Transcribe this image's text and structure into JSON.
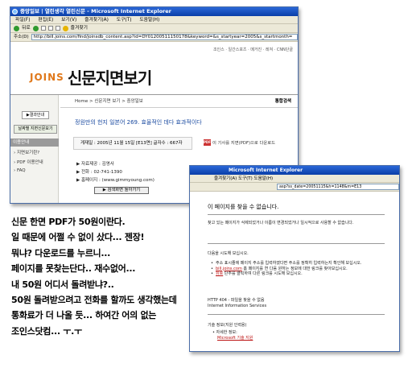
{
  "window1": {
    "title": "중앙일보 | 열린생각 열린신문 - Microsoft Internet Explorer",
    "menu": [
      "파일(F)",
      "편집(E)",
      "보기(V)",
      "즐겨찾기(A)",
      "도구(T)",
      "도움말(H)"
    ],
    "toolbar": {
      "back": "뒤로",
      "favorites": "즐겨찾기"
    },
    "address_label": "주소(D)",
    "address_url": "http://bill.joins.com/find/joinsdb_content.asp?id=DY01200511150178&keyword=&s_startyear=2005&s_startmonth=",
    "top_links": "조인스 · 일간스포츠 · 메거진 · 레져 · CNN단골",
    "logo_brand": "JOINS",
    "logo_service": "신문지면보기",
    "breadcrumb": "Home > 신문지면 보기 > 중앙일보",
    "integrated_search": "통합검색",
    "left_panel": {
      "result_button": "▶결과안내",
      "date_button": "날짜별 지면신문보기",
      "section_head": "이용안내",
      "items": [
        "지면보기란?",
        "PDF 이용안내",
        "FAQ"
      ]
    },
    "article": {
      "title": "정원만의 헌지 일본어 269. 효율적인 데다 효과적이다",
      "meta": "게재일 : 2005년 11월 15일 [E13면]   글자수 : 667자",
      "pdf_link": "이 기사를 지면(PDF)으로 다운로드",
      "pdf_icon_text": "PDF",
      "info": [
        "▶ 자료제공 : 김영사",
        "▶ 전화 : 02-741-1390",
        "▶ 홈페이지 : (www.gimmyoung.com)"
      ],
      "scrap_button": "▶ 검색화면 돌아가기"
    }
  },
  "window2": {
    "title": "Microsoft Internet Explorer",
    "menu": "즐겨찾기(A)   도구(T)   도움말(H)",
    "address_url": "asp?ss_date=20051115&h=1148&m=E13",
    "error": {
      "title": "이 페이지를 찾을 수 없습니다.",
      "desc": "찾고 있는 페이지가 삭제되었거나 이름이 변경되었거나 일시적으로 사용할 수 없습니다.",
      "try_head": "다음을 시도해 보십시오.",
      "bullets": [
        "주소 표시줄에 페이지 주소를 입력하였다면 주소를 정확히 입력하는지 확인해 보십시오.",
        "bill.joins.com",
        "홈 페이지를 연 다음 원하는 정보에 대한 링크를 찾아보십시오.",
        "뒤로",
        "단추를 클릭하여 다른 링크를 시도해 보십시오."
      ],
      "http_line1": "HTTP 404 - 파일을 찾을 수 없음",
      "http_line2": "Internet Information Services",
      "tech_head": "기술 정보(지원 인력용)",
      "tech_item1": "자세한 정보:",
      "tech_item2": "Microsoft 기술 지원"
    }
  },
  "caption": [
    "신문 한면 PDF가 50원이란다.",
    "일 때문에 어쩔 수 없이 샀다... 젠장!",
    "뭐냐? 다운로드를 누르니...",
    "페이지를 못찾는단다.. 재수없어...",
    "내 50원 어디서 돌려받냐?..",
    "50원 돌려받으려고 전화를 할까도 생각했는데",
    "통화료가 더 나올 듯... 하여간 어의 없는",
    "조인스닷컴... ㅜ.ㅜ"
  ],
  "colors": {
    "titlebar": "#0a3ea8",
    "logo_accent": "#e0781a",
    "article_title": "#1a4aa0",
    "link": "#b11111"
  }
}
